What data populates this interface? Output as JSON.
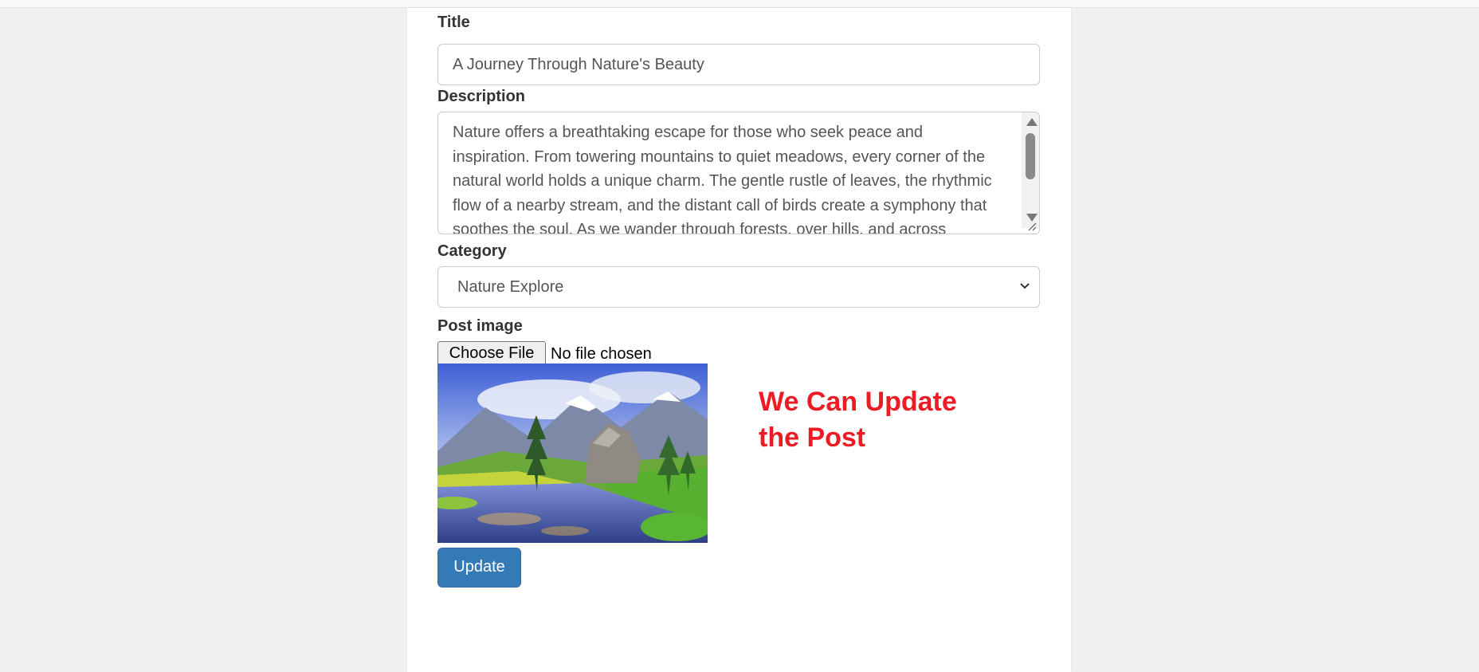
{
  "form": {
    "title_label": "Title",
    "title_value": "A Journey Through Nature's Beauty",
    "description_label": "Description",
    "description_value": "Nature offers a breathtaking escape for those who seek peace and inspiration. From towering mountains to quiet meadows, every corner of the natural world holds a unique charm. The gentle rustle of leaves, the rhythmic flow of a nearby stream, and the distant call of birds create a symphony that soothes the soul. As we wander through forests, over hills, and across valleys, we reconnect with the earth and rediscover",
    "category_label": "Category",
    "category_value": "Nature Explore",
    "image_label": "Post image",
    "file_button": "Choose File",
    "file_status": "No file chosen",
    "update_button": "Update"
  },
  "annotation": {
    "line1": "We Can Update",
    "line2": "the Post"
  },
  "colors": {
    "accent": "#337ab7",
    "annotation": "#ed1c24"
  }
}
